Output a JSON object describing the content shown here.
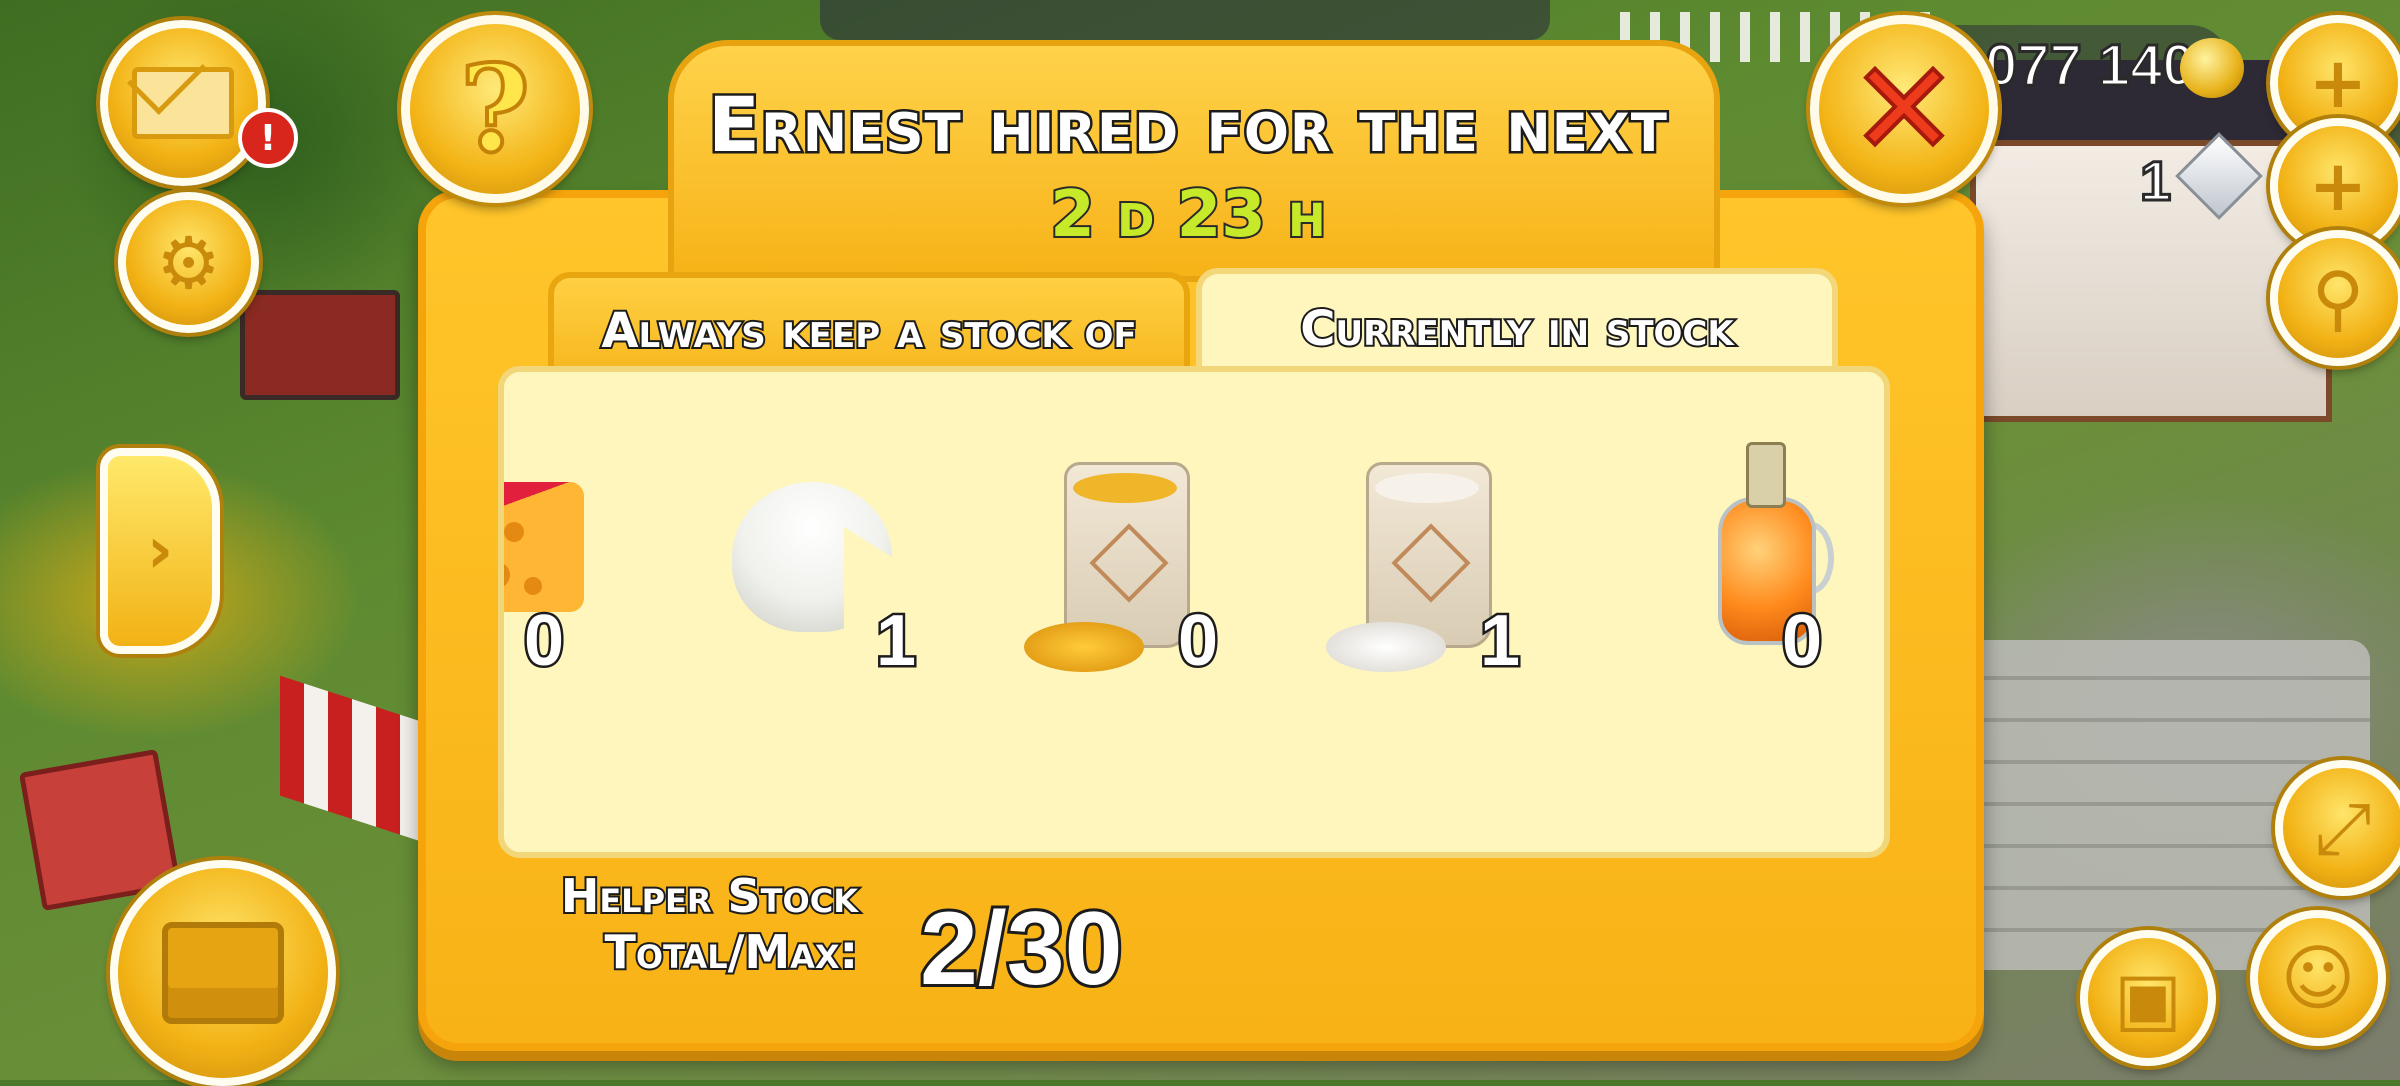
{
  "hud": {
    "alert_badge": "!",
    "coins": "077 140",
    "gems": "1",
    "side_arrow": "›",
    "icons": [
      "mail-icon",
      "gear-icon",
      "cash-register-icon",
      "plus-icon",
      "magnifier-icon",
      "chevron-right-icon"
    ]
  },
  "dialog": {
    "title": "Ernest hired for the next",
    "time_remaining": "2 d 23 h",
    "help_glyph": "?",
    "close_glyph": "✕",
    "tabs": [
      {
        "label": "Always keep a stock of",
        "active": false
      },
      {
        "label": "Currently in stock",
        "active": true
      }
    ],
    "items": [
      {
        "name": "cheese-icon",
        "count": "0"
      },
      {
        "name": "goat-cheese-icon",
        "count": "1"
      },
      {
        "name": "corn-feed-sack-icon",
        "count": "0"
      },
      {
        "name": "flour-sack-icon",
        "count": "1"
      },
      {
        "name": "syrup-bottle-icon",
        "count": "0"
      }
    ],
    "stock_label_line1": "Helper Stock",
    "stock_label_line2": "Total/Max:",
    "stock_value": "2/30"
  },
  "colors": {
    "dialog_orange": "#f8b216",
    "panel_cream": "#fff6be",
    "timer_green": "#c6ea2a",
    "close_red": "#ee3b1c"
  }
}
